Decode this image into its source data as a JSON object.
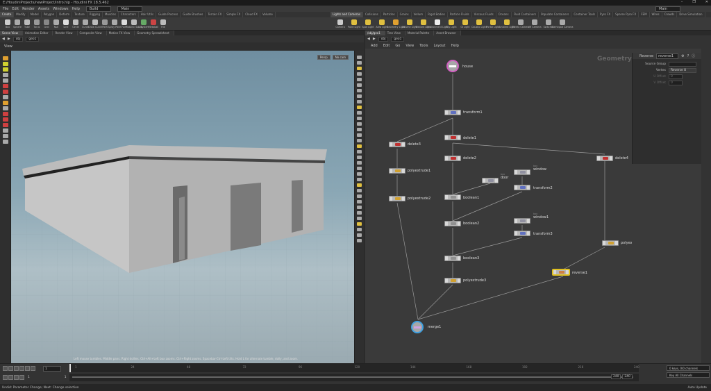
{
  "window": {
    "title": "E:/HoudiniProjects/newProject/intro.hip - Houdini FX 18.5.462",
    "controls": [
      "–",
      "❐",
      "✕"
    ]
  },
  "menubar": {
    "items": [
      "File",
      "Edit",
      "Render",
      "Assets",
      "Windows",
      "Help"
    ],
    "desktop": "Build",
    "desktop_main": "Main",
    "right_desktop": "Main"
  },
  "shelf_tabs_left": [
    "Create",
    "Modify",
    "Model",
    "Polygon",
    "Deform",
    "Texture",
    "Rigging",
    "Muscles",
    "Characters",
    "Hair Utils",
    "Guide Process",
    "Guide Brushes",
    "Terrain FX",
    "Simple FX",
    "Cloud FX",
    "Volume"
  ],
  "shelf_tabs_right": [
    "Lights and Cameras",
    "Collisions",
    "Particles",
    "Grains",
    "Vellum",
    "Rigid Bodies",
    "Particle Fluids",
    "Viscous Fluids",
    "Oceans",
    "Fluid Containers",
    "Populate Containers",
    "Container Tools",
    "Pyro FX",
    "Sparse Pyro FX",
    "FEM",
    "Wires",
    "Crowds",
    "Drive Simulation"
  ],
  "shelf_tools_left": [
    "Box",
    "Sphere",
    "Tube",
    "Torus",
    "Grid",
    "Null",
    "Line",
    "Circle",
    "Curve",
    "Draw Curve",
    "Path",
    "Spray Paint",
    "Font",
    "Platonic Solids",
    "L-System",
    "Metaball",
    "File"
  ],
  "shelf_tools_right": [
    "Camera",
    "Point Light",
    "Spot Light",
    "Area Light",
    "Geometry Light",
    "Volume Light",
    "Distant Light",
    "Environment Light",
    "Sky Light",
    "GI Light",
    "Caustic Light",
    "Portal Light",
    "Ambient Light",
    "Stereo Camera",
    "VR Camera",
    "Switcher",
    "Gamepad Camera"
  ],
  "left_pane_tabs": [
    "Scene View",
    "Animation Editor",
    "Render View",
    "Composite View",
    "Motion FX View",
    "Geometry Spreadsheet"
  ],
  "right_pane_tabs": [
    "/obj/geo1",
    "Tree View",
    "Material Palette",
    "Asset Browser"
  ],
  "path_left": {
    "context": "obj",
    "node": "geo1"
  },
  "path_right": {
    "context": "obj",
    "node": "geo1"
  },
  "viewport": {
    "title": "View",
    "camera": "Persp",
    "display": "No cam",
    "hint": "Left mouse tumbles. Middle pans. Right dollies. Ctrl+Alt+Left box zooms. Ctrl+Right zooms. Spacebar-Ctrl-Left tilts. Hold L for alternate tumble, dolly, and zoom."
  },
  "network": {
    "menu": [
      "Add",
      "Edit",
      "Go",
      "View",
      "Tools",
      "Layout",
      "Help"
    ],
    "context_label": "Geometry",
    "nodes": [
      {
        "name": "house"
      },
      {
        "name": "transform1"
      },
      {
        "name": "delete1"
      },
      {
        "name": "delete3"
      },
      {
        "name": "delete2"
      },
      {
        "name": "delete4"
      },
      {
        "name": "polyextrude1"
      },
      {
        "name": "polyextrude2"
      },
      {
        "name": "box",
        "sub": "door"
      },
      {
        "name": "window",
        "sub": "box"
      },
      {
        "name": "transform2"
      },
      {
        "name": "boolean1"
      },
      {
        "name": "boolean2"
      },
      {
        "name": "window1",
        "sub": "box"
      },
      {
        "name": "transform3"
      },
      {
        "name": "boolean3"
      },
      {
        "name": "polyextrude3"
      },
      {
        "name": "polyextrude4"
      },
      {
        "name": "reverse1"
      },
      {
        "name": "merge1"
      }
    ]
  },
  "params": {
    "type": "Reverse",
    "node_name": "reverse1",
    "rows": [
      {
        "label": "Source Group",
        "value": ""
      },
      {
        "label": "Vertex",
        "value": "Reverse U"
      },
      {
        "label": "U Offset",
        "value": "0"
      },
      {
        "label": "V Offset",
        "value": "0"
      }
    ]
  },
  "timeline": {
    "frame": "1",
    "start": "1",
    "start2": "1",
    "ticks": [
      "1",
      "24",
      "48",
      "72",
      "96",
      "120",
      "144",
      "168",
      "192",
      "216",
      "240"
    ],
    "end1": "240",
    "end2": "240",
    "keys_label": "0 keys, 0/0 channels",
    "key_all": "Key All Channels",
    "auto_update": "Auto Update"
  },
  "status": {
    "text": "Undid: Parameter Change; Next: Change selection"
  }
}
